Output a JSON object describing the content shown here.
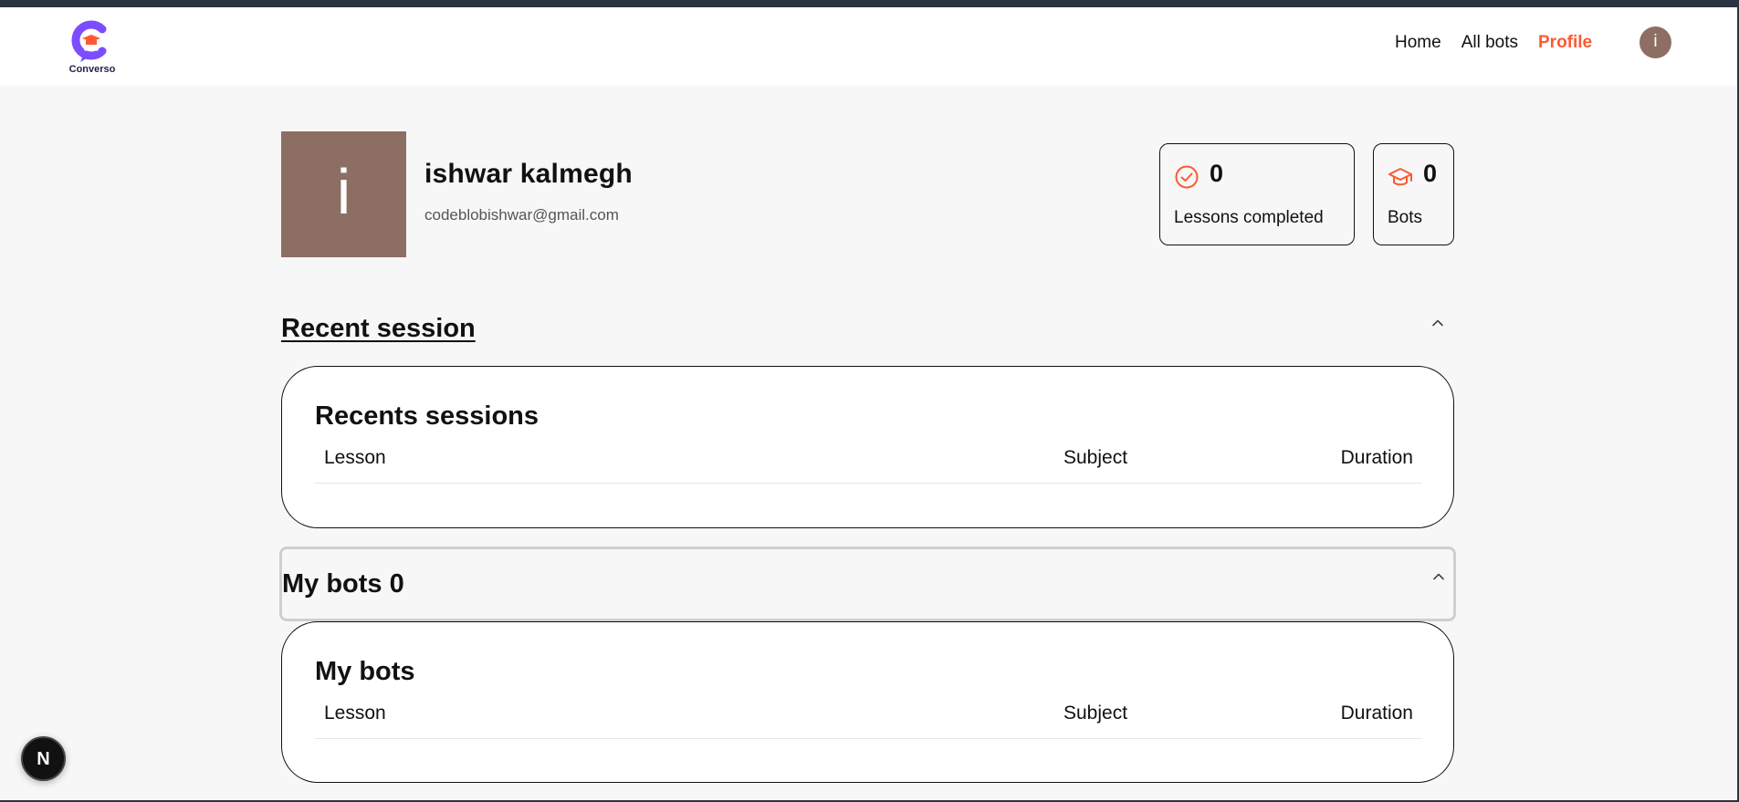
{
  "brand": {
    "name": "Converso",
    "accent": "#fe5933",
    "logo_color": "#7c4dff"
  },
  "nav": {
    "items": [
      {
        "label": "Home",
        "active": false
      },
      {
        "label": "All bots",
        "active": false
      },
      {
        "label": "Profile",
        "active": true
      }
    ],
    "avatar_initial": "i"
  },
  "profile": {
    "avatar_initial": "i",
    "avatar_color": "#8d6e63",
    "name": "ishwar kalmegh",
    "email": "codeblobishwar@gmail.com"
  },
  "stats": [
    {
      "icon": "check-circle-icon",
      "value": "0",
      "label": "Lessons completed"
    },
    {
      "icon": "graduation-cap-icon",
      "value": "0",
      "label": "Bots"
    }
  ],
  "sections": {
    "recent": {
      "header": "Recent session",
      "card_title": "Recents sessions",
      "columns": [
        "Lesson",
        "Subject",
        "Duration"
      ],
      "rows": []
    },
    "mybots": {
      "header": "My bots 0",
      "card_title": "My bots",
      "columns": [
        "Lesson",
        "Subject",
        "Duration"
      ],
      "rows": []
    }
  },
  "dev_badge": "N"
}
